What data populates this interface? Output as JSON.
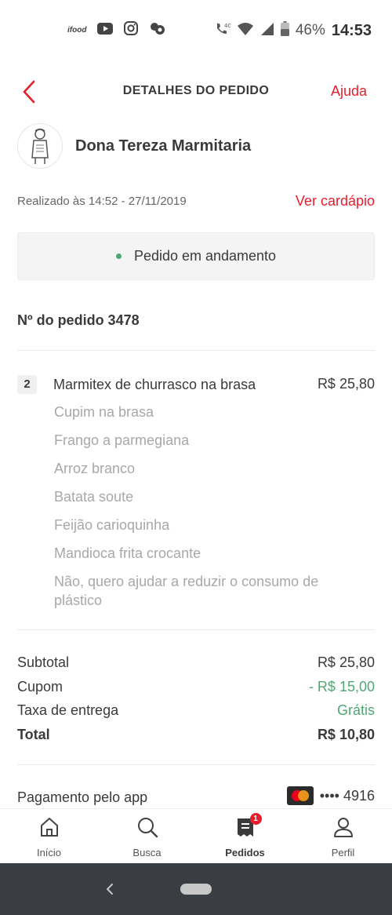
{
  "status_bar": {
    "ifood_label": "ifood",
    "battery_percent": "46%",
    "time": "14:53",
    "network_label": "4G"
  },
  "header": {
    "title": "DETALHES DO PEDIDO",
    "help_label": "Ajuda"
  },
  "restaurant": {
    "name": "Dona Tereza Marmitaria"
  },
  "order": {
    "placed_at": "Realizado às 14:52 - 27/11/2019",
    "menu_link": "Ver cardápio",
    "status": "Pedido em andamento",
    "number_label": "Nº do pedido 3478"
  },
  "item": {
    "quantity": "2",
    "name": "Marmitex de churrasco na brasa",
    "price": "R$ 25,80",
    "options": [
      "Cupim na brasa",
      "Frango a parmegiana",
      "Arroz branco",
      "Batata soute",
      "Feijão carioquinha",
      "Mandioca frita crocante",
      "Não, quero ajudar a reduzir o consumo de plástico"
    ]
  },
  "totals": {
    "subtotal_label": "Subtotal",
    "subtotal_value": "R$ 25,80",
    "coupon_label": "Cupom",
    "coupon_value": "- R$ 15,00",
    "delivery_label": "Taxa de entrega",
    "delivery_value": "Grátis",
    "total_label": "Total",
    "total_value": "R$ 10,80"
  },
  "payment": {
    "label": "Pagamento pelo app",
    "card_number": "•••• 4916"
  },
  "bottom_nav": {
    "items": [
      {
        "label": "Início"
      },
      {
        "label": "Busca"
      },
      {
        "label": "Pedidos",
        "badge": "1"
      },
      {
        "label": "Perfil"
      }
    ]
  },
  "colors": {
    "accent_red": "#ea1d2c",
    "success_green": "#50a773",
    "system_nav_bg": "#3a3d42"
  }
}
